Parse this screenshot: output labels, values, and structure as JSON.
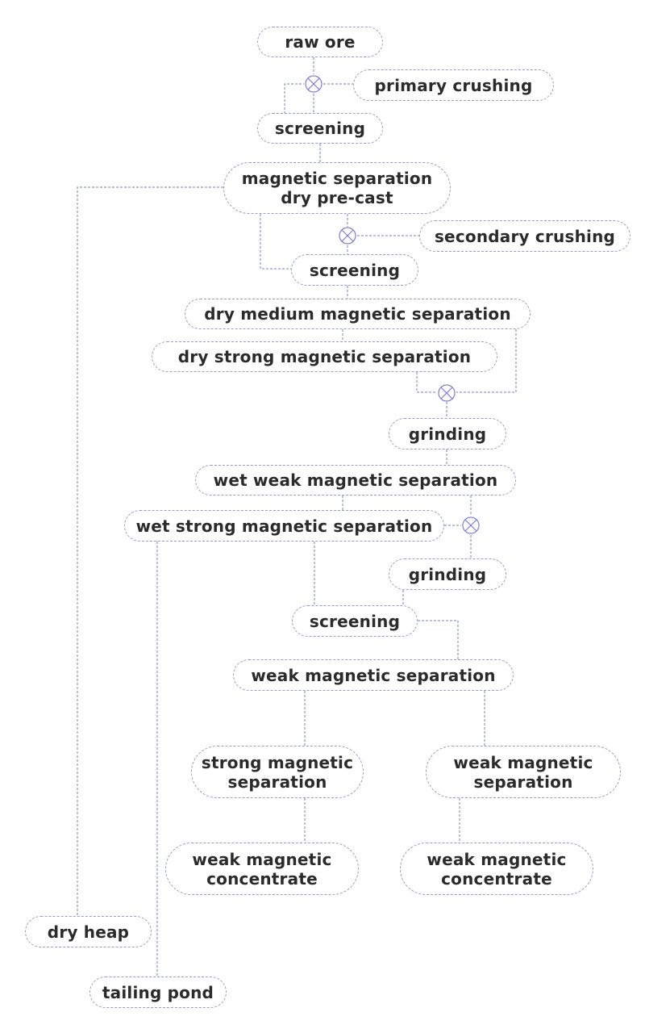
{
  "diagram": {
    "type": "process-flowchart",
    "colors": {
      "border": "#9a9ad8",
      "connector": "#7c7cc8",
      "text": "#2b2b2b",
      "background": "#ffffff"
    },
    "nodes": {
      "raw_ore": "raw ore",
      "primary_crushing": "primary crushing",
      "screening_1": "screening",
      "mag_sep_dry_precast": "magnetic separation\ndry pre-cast",
      "secondary_crushing": "secondary crushing",
      "screening_2": "screening",
      "dry_medium_mag_sep": "dry medium magnetic separation",
      "dry_strong_mag_sep": "dry strong magnetic separation",
      "grinding_1": "grinding",
      "wet_weak_mag_sep": "wet weak magnetic separation",
      "wet_strong_mag_sep": "wet strong magnetic separation",
      "grinding_2": "grinding",
      "screening_3": "screening",
      "weak_mag_sep": "weak magnetic separation",
      "strong_mag_sep_2": "strong magnetic\nseparation",
      "weak_mag_sep_2": "weak magnetic\nseparation",
      "weak_mag_concentrate_left": "weak magnetic\nconcentrate",
      "weak_mag_concentrate_right": "weak magnetic\nconcentrate",
      "dry_heap": "dry heap",
      "tailing_pond": "tailing pond"
    },
    "junction_icon": "circled-x-merge-icon"
  }
}
